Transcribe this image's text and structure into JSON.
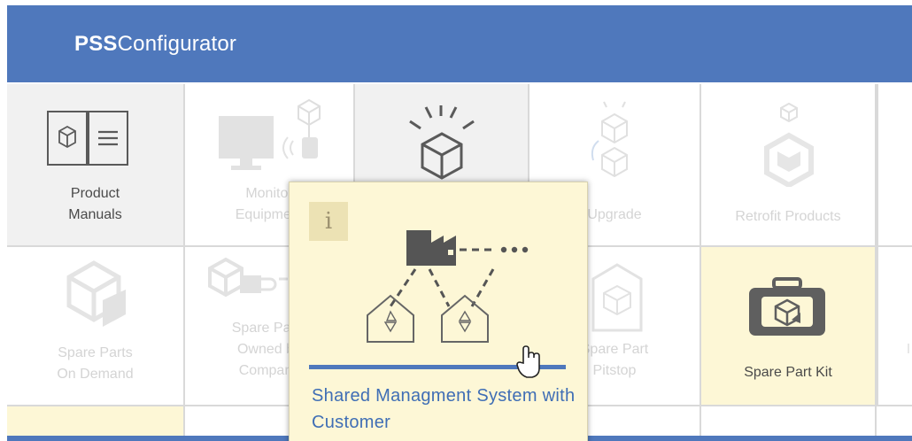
{
  "app": {
    "title_bold": "PSS",
    "title_rest": "Configurator"
  },
  "tiles": {
    "product_manuals": "Product\nManuals",
    "monitor_equipment": "Monitor\nEquipment",
    "upgrade": "Upgrade",
    "retrofit": "Retrofit Products",
    "spare_parts_on_demand": "Spare Parts\nOn Demand",
    "spare_parts_owned": "Spare Parts\nOwned by\nCompany",
    "spare_part_pitstop": "Spare Part\nPitstop",
    "spare_part_kit": "Spare Part Kit"
  },
  "popup": {
    "info_glyph": "i",
    "title": "Shared Managment System with Customer"
  },
  "colors": {
    "header": "#4f78bc",
    "highlight": "#fdf7d6",
    "link": "#3f6eb5"
  }
}
